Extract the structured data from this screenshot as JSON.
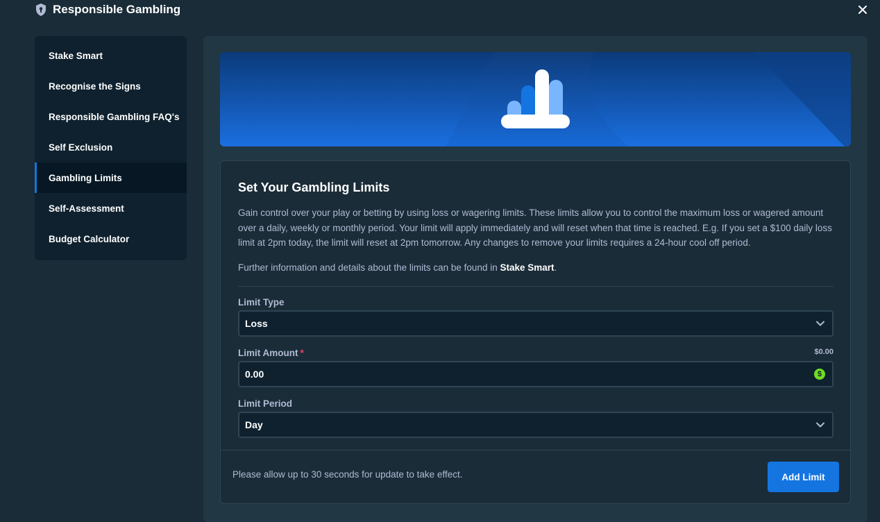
{
  "header": {
    "title": "Responsible Gambling",
    "shield_icon": "shield-icon",
    "close_icon": "close-icon"
  },
  "sidebar": {
    "items": [
      {
        "label": "Stake Smart"
      },
      {
        "label": "Recognise the Signs"
      },
      {
        "label": "Responsible Gambling FAQ's"
      },
      {
        "label": "Self Exclusion"
      },
      {
        "label": "Gambling Limits",
        "active": true
      },
      {
        "label": "Self-Assessment"
      },
      {
        "label": "Budget Calculator"
      }
    ]
  },
  "banner": {
    "icon": "bar-chart-icon",
    "colors": {
      "bg_dark": "#0b3a7a",
      "bg_light": "#1a6fe0",
      "bar_light": "#7ab6ff",
      "bar_blue": "#1475e1",
      "bar_white": "#ffffff"
    }
  },
  "card": {
    "title": "Set Your Gambling Limits",
    "description": "Gain control over your play or betting by using loss or wagering limits. These limits allow you to control the maximum loss or wagered amount over a daily, weekly or monthly period. Your limit will apply immediately and will reset when that time is reached. E.g. If you set a $100 daily loss limit at 2pm today, the limit will reset at 2pm tomorrow. Any changes to remove your limits requires a 24-hour cool off period.",
    "further_text": "Further information and details about the limits can be found in ",
    "further_link": "Stake Smart",
    "further_end": "."
  },
  "form": {
    "limit_type": {
      "label": "Limit Type",
      "value": "Loss"
    },
    "limit_amount": {
      "label": "Limit Amount",
      "required_mark": "*",
      "hint": "$0.00",
      "value": "0.00",
      "currency_symbol": "$"
    },
    "limit_period": {
      "label": "Limit Period",
      "value": "Day"
    }
  },
  "footer": {
    "note": "Please allow up to 30 seconds for update to take effect.",
    "add_button": "Add Limit"
  },
  "colors": {
    "page_bg": "#1a2c38",
    "sidebar_bg": "#0f212e",
    "panel_bg": "#213743",
    "accent": "#1475e1",
    "currency_green": "#6fdd22",
    "required_red": "#ed4163"
  }
}
